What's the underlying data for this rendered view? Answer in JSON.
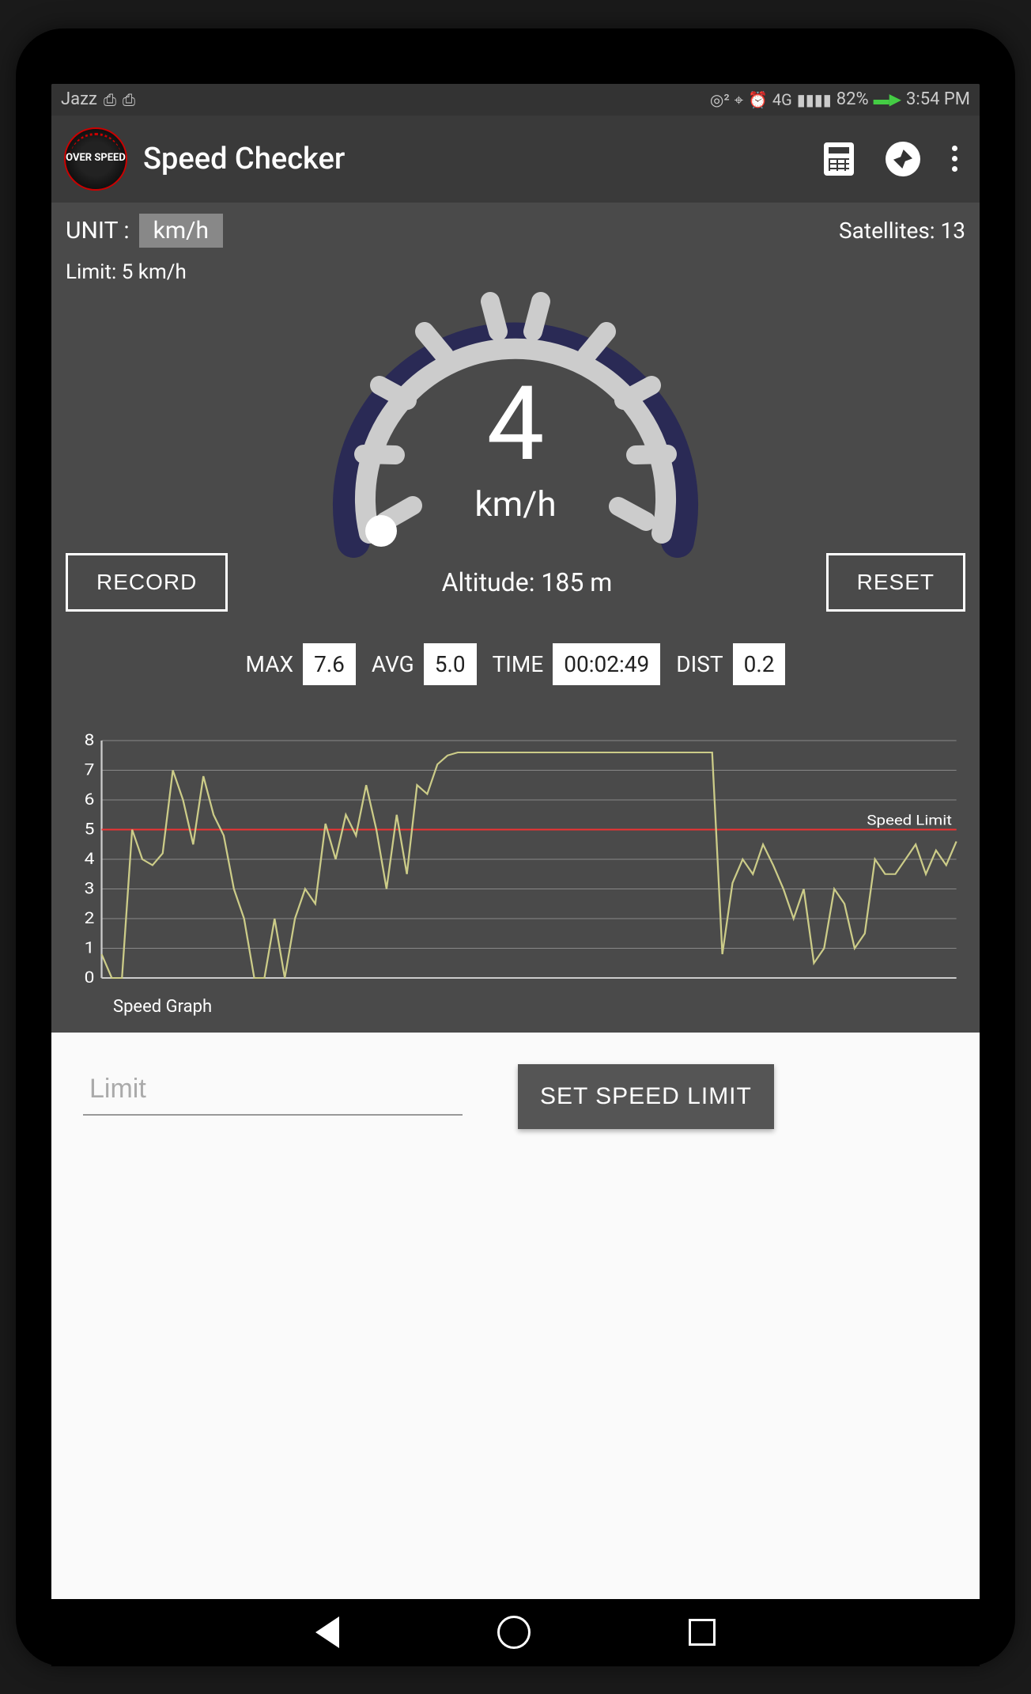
{
  "status_bar": {
    "carrier": "Jazz",
    "battery": "82%",
    "time": "3:54 PM",
    "network": "4G"
  },
  "app_bar": {
    "title": "Speed Checker",
    "logo_text": "OVER SPEED"
  },
  "info": {
    "unit_label": "UNIT :",
    "unit_value": "km/h",
    "satellites_label": "Satellites: 13",
    "limit_text": "Limit: 5 km/h"
  },
  "gauge": {
    "value": "4",
    "unit": "km/h"
  },
  "controls": {
    "record": "RECORD",
    "reset": "RESET",
    "altitude": "Altitude: 185 m"
  },
  "stats": {
    "max_label": "MAX",
    "max_value": "7.6",
    "avg_label": "AVG",
    "avg_value": "5.0",
    "time_label": "TIME",
    "time_value": "00:02:49",
    "dist_label": "DIST",
    "dist_value": "0.2"
  },
  "chart_data": {
    "type": "line",
    "title": "Speed Graph",
    "ylabel": "",
    "ylim": [
      0,
      8
    ],
    "y_ticks": [
      0,
      1,
      2,
      3,
      4,
      5,
      6,
      7,
      8
    ],
    "speed_limit": 5,
    "speed_limit_label": "Speed Limit",
    "values": [
      0.8,
      0,
      0,
      5,
      4,
      3.8,
      4.2,
      7,
      6,
      4.5,
      6.8,
      5.5,
      4.8,
      3,
      2,
      0,
      0,
      2,
      0,
      2,
      3,
      2.5,
      5.2,
      4,
      5.5,
      4.8,
      6.5,
      5,
      3,
      5.5,
      3.5,
      6.5,
      6.2,
      7.2,
      7.5,
      7.6,
      7.6,
      7.6,
      7.6,
      7.6,
      7.6,
      7.6,
      7.6,
      7.6,
      7.6,
      7.6,
      7.6,
      7.6,
      7.6,
      7.6,
      7.6,
      7.6,
      7.6,
      7.6,
      7.6,
      7.6,
      7.6,
      7.6,
      7.6,
      7.6,
      7.6,
      0.8,
      3.2,
      4,
      3.5,
      4.5,
      3.8,
      3,
      2,
      3,
      0.5,
      1,
      3,
      2.5,
      1,
      1.5,
      4,
      3.5,
      3.5,
      4,
      4.5,
      3.5,
      4.3,
      3.8,
      4.6
    ]
  },
  "input": {
    "placeholder": "Limit",
    "button": "SET SPEED LIMIT"
  }
}
